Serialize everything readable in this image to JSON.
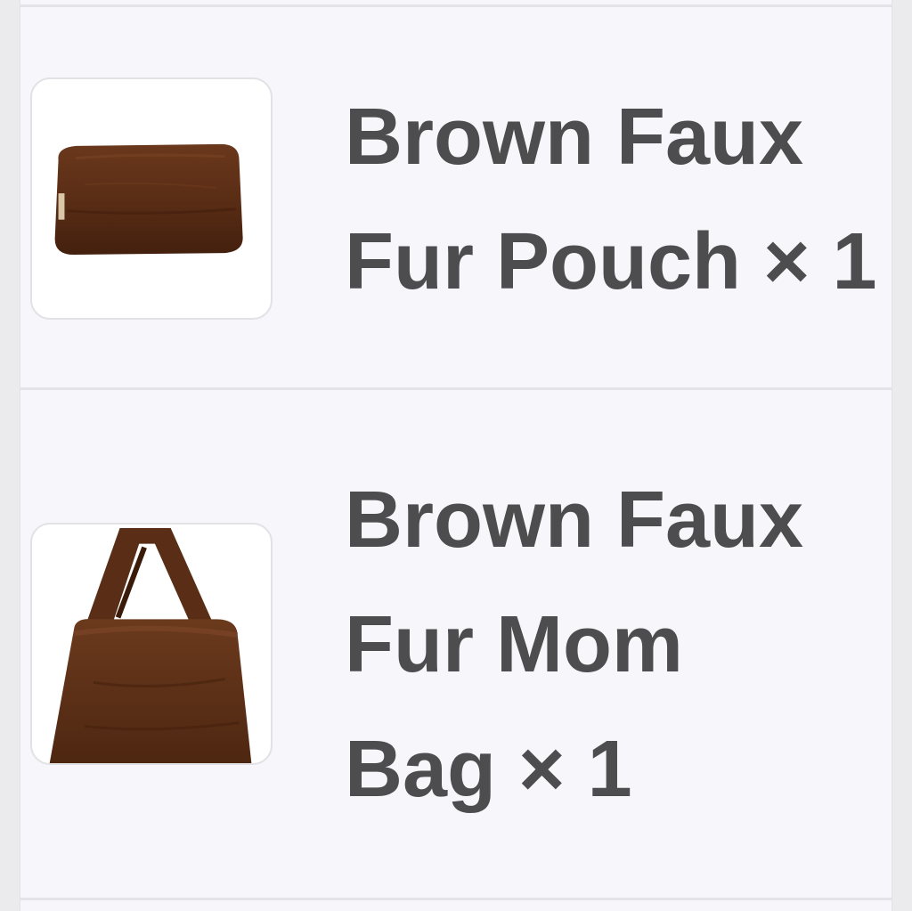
{
  "cart": {
    "items": [
      {
        "name_lines": [
          "Brown Faux",
          "Fur Pouch × 1"
        ],
        "image_icon": "faux-fur-pouch-image",
        "quantity": 1
      },
      {
        "name_lines": [
          "Brown Faux",
          "Fur Mom",
          "Bag × 1"
        ],
        "image_icon": "faux-fur-bag-image",
        "quantity": 1
      }
    ]
  },
  "colors": {
    "background": "#f7f7fb",
    "text": "#4d4d4f",
    "divider": "#e4e4e8",
    "fur_brown": "#5a2e16"
  }
}
